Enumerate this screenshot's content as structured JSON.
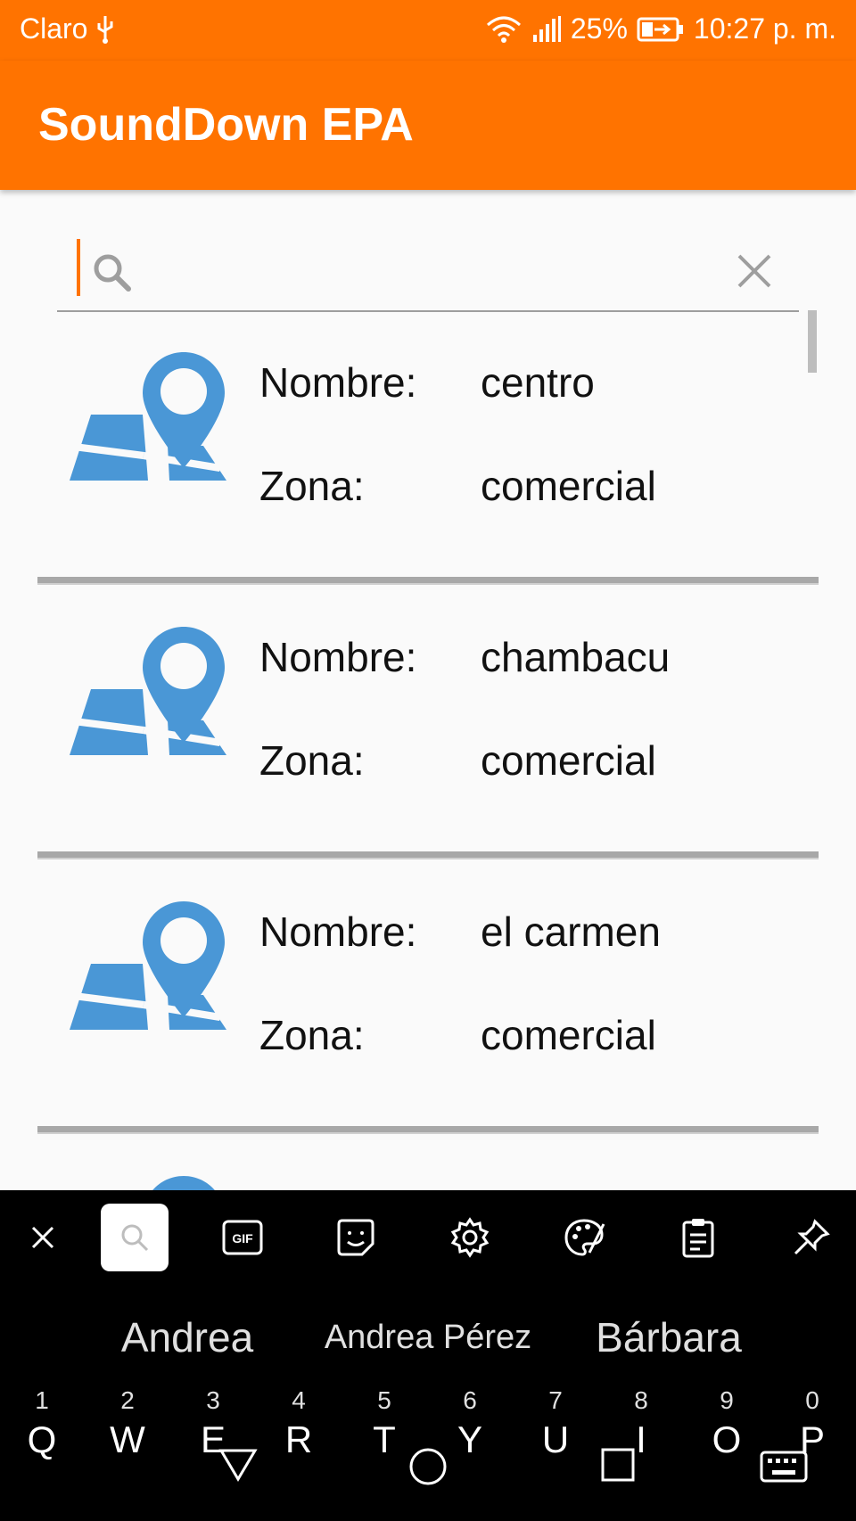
{
  "status_bar": {
    "carrier": "Claro",
    "battery": "25%",
    "time": "10:27 p. m."
  },
  "app_bar": {
    "title": "SoundDown EPA"
  },
  "search": {
    "value": "",
    "placeholder": ""
  },
  "list": {
    "items": [
      {
        "name_label": "Nombre:",
        "name_value": "centro",
        "zone_label": "Zona:",
        "zone_value": "comercial"
      },
      {
        "name_label": "Nombre:",
        "name_value": "chambacu",
        "zone_label": "Zona:",
        "zone_value": "comercial"
      },
      {
        "name_label": "Nombre:",
        "name_value": "el carmen",
        "zone_label": "Zona:",
        "zone_value": "comercial"
      }
    ]
  },
  "keyboard": {
    "toolbar_icons": [
      "close-icon",
      "search-icon",
      "gif-icon",
      "sticker-icon",
      "settings-icon",
      "palette-icon",
      "clipboard-icon",
      "pin-icon"
    ],
    "gif_label": "GIF",
    "suggestions": [
      "Andrea",
      "Andrea Pérez",
      "Bárbara"
    ],
    "keys": [
      {
        "num": "1",
        "letter": "Q"
      },
      {
        "num": "2",
        "letter": "W"
      },
      {
        "num": "3",
        "letter": "E"
      },
      {
        "num": "4",
        "letter": "R"
      },
      {
        "num": "5",
        "letter": "T"
      },
      {
        "num": "6",
        "letter": "Y"
      },
      {
        "num": "7",
        "letter": "U"
      },
      {
        "num": "8",
        "letter": "I"
      },
      {
        "num": "9",
        "letter": "O"
      },
      {
        "num": "0",
        "letter": "P"
      }
    ]
  },
  "colors": {
    "primary": "#ff7300",
    "map_icon": "#4a97d6"
  }
}
